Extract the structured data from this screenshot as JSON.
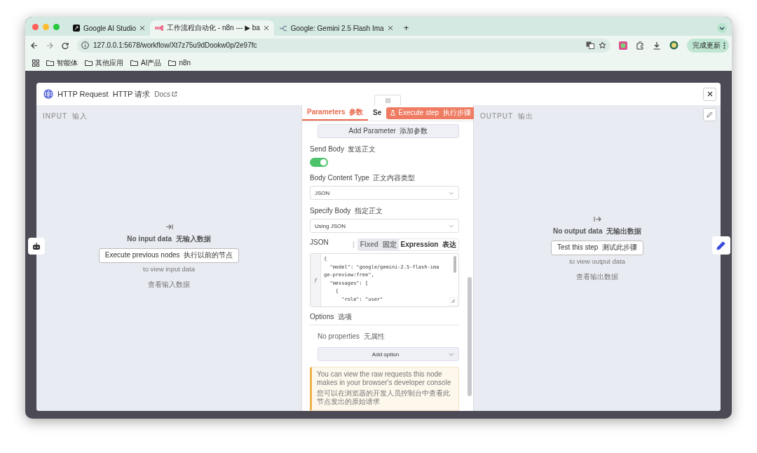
{
  "browser": {
    "tabs": [
      {
        "kind": "square",
        "title": "Google AI Studio",
        "selected": false
      },
      {
        "kind": "nodes",
        "title": "工作流程自动化 - n8n --- ▶ ba",
        "selected": true
      },
      {
        "kind": "arrows",
        "title": "Google: Gemini 2.5 Flash Ima",
        "selected": false
      }
    ],
    "new_tab": "+",
    "address": "127.0.0.1:5678/workflow/Xt7z75u9dDookw0p/2e97fc",
    "update_button": "完成更新",
    "bookmarks": [
      "智能体",
      "其他应用",
      "AI产品",
      "n8n"
    ]
  },
  "node_modal": {
    "title": "HTTP Request  HTTP 请求",
    "docs_link": "Docs",
    "input_panel": {
      "heading": "INPUT  输入",
      "empty_title": "No input data  无输入数据",
      "action_button": "Execute previous nodes  执行以前的节点",
      "hint": "to view input data",
      "hint_translation": "查看输入数据"
    },
    "parameters_panel": {
      "tabs": [
        {
          "label": "Parameters  参数",
          "selected": true
        },
        {
          "label": "Se",
          "selected": false
        }
      ],
      "execute_button": "Execute step  执行步骤",
      "add_parameter_button": "Add Parameter  添加参数",
      "send_body": {
        "label": "Send Body  发送正文",
        "on": true
      },
      "fields": [
        {
          "label": "Body Content Type  正文内容类型",
          "value": "JSON"
        },
        {
          "label": "Specify Body  指定正文",
          "value": "Using JSON"
        }
      ],
      "json_field": {
        "label": "JSON",
        "modes": [
          {
            "label": "Fixed  固定",
            "selected": false
          },
          {
            "label": "Expression  表达",
            "selected": true
          }
        ],
        "lines": [
          "{",
          "  \"model\": \"google/gemini-2.5-flash-ima",
          "ge-preview:free\",",
          "  \"messages\": [",
          "    {",
          "      \"role\": \"user\""
        ]
      },
      "options": {
        "heading": "Options  选项",
        "empty": "No properties  无属性",
        "add_button": "Add option"
      },
      "notice": {
        "text": "You can view the raw requests this node makes in your browser's developer console",
        "translation": "您可以在浏览器的开发人员控制台中查看此节点发出的原始请求"
      }
    },
    "output_panel": {
      "heading": "OUTPUT  输出",
      "empty_title": "No output data  无输出数据",
      "action_button": "Test this step  测试此步骤",
      "hint": "to view output data",
      "hint_translation": "查看输出数据"
    }
  }
}
